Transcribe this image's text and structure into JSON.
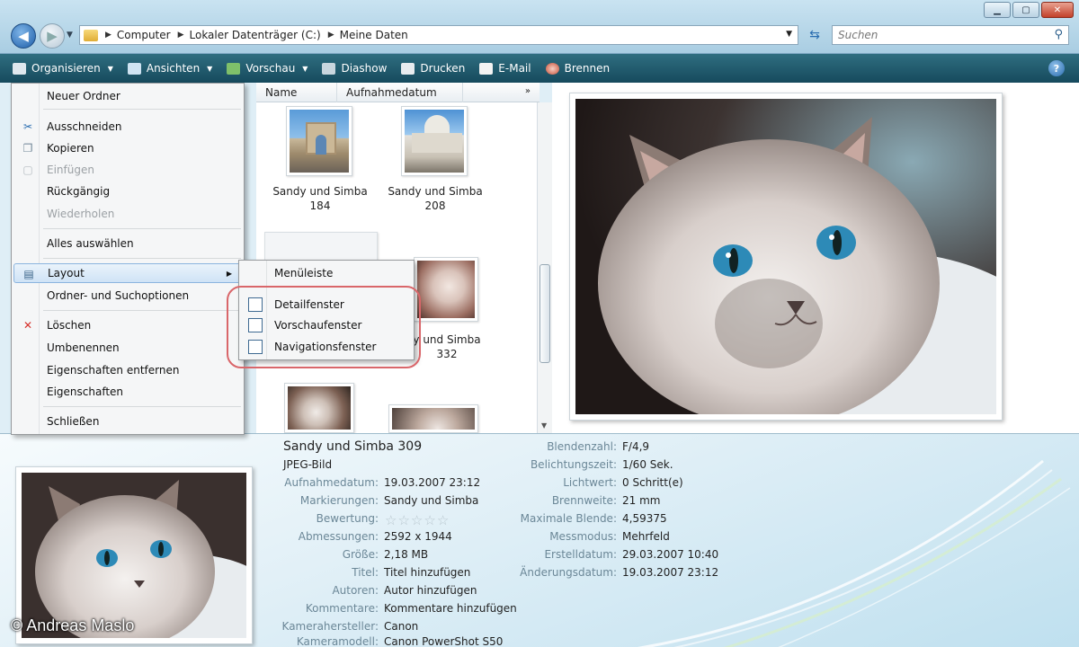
{
  "address": {
    "breadcrumbs": [
      "Computer",
      "Lokaler Datenträger (C:)",
      "Meine Daten"
    ],
    "search_placeholder": "Suchen"
  },
  "toolbar": {
    "items": [
      {
        "label": "Organisieren",
        "icon": "organize-icon",
        "dropdown": true
      },
      {
        "label": "Ansichten",
        "icon": "views-icon",
        "dropdown": true
      },
      {
        "label": "Vorschau",
        "icon": "preview-icon",
        "dropdown": true
      },
      {
        "label": "Diashow",
        "icon": "slideshow-icon",
        "dropdown": false
      },
      {
        "label": "Drucken",
        "icon": "print-icon",
        "dropdown": false
      },
      {
        "label": "E-Mail",
        "icon": "email-icon",
        "dropdown": false
      },
      {
        "label": "Brennen",
        "icon": "burn-icon",
        "dropdown": false
      }
    ],
    "help": "?"
  },
  "filelist": {
    "columns": [
      "Name",
      "Aufnahmedatum"
    ],
    "more": "»",
    "items": [
      {
        "line1": "Sandy und Simba",
        "line2": "184"
      },
      {
        "line1": "Sandy und Simba",
        "line2": "208"
      },
      {
        "line1": "y und Simba",
        "line2": "332"
      }
    ]
  },
  "organize_menu": {
    "items": [
      {
        "label": "Neuer Ordner",
        "disabled": false,
        "icon": ""
      },
      {
        "label": "Ausschneiden",
        "disabled": false,
        "icon": "cut-icon"
      },
      {
        "label": "Kopieren",
        "disabled": false,
        "icon": "copy-icon"
      },
      {
        "label": "Einfügen",
        "disabled": true,
        "icon": "paste-icon"
      },
      {
        "label": "Rückgängig",
        "disabled": false,
        "icon": ""
      },
      {
        "label": "Wiederholen",
        "disabled": true,
        "icon": ""
      },
      {
        "label": "Alles auswählen",
        "disabled": false,
        "icon": ""
      },
      {
        "label": "Layout",
        "disabled": false,
        "icon": "layout-icon",
        "submenu": true
      },
      {
        "label": "Ordner- und Suchoptionen",
        "disabled": false,
        "icon": ""
      },
      {
        "label": "Löschen",
        "disabled": false,
        "icon": "delete-icon"
      },
      {
        "label": "Umbenennen",
        "disabled": false,
        "icon": ""
      },
      {
        "label": "Eigenschaften entfernen",
        "disabled": false,
        "icon": ""
      },
      {
        "label": "Eigenschaften",
        "disabled": false,
        "icon": ""
      },
      {
        "label": "Schließen",
        "disabled": false,
        "icon": ""
      }
    ]
  },
  "layout_submenu": {
    "items": [
      {
        "label": "Menüleiste"
      },
      {
        "label": "Detailfenster"
      },
      {
        "label": "Vorschaufenster"
      },
      {
        "label": "Navigationsfenster"
      }
    ]
  },
  "details": {
    "filename": "Sandy und Simba 309",
    "filetype": "JPEG-Bild",
    "left_props": [
      {
        "label": "Aufnahmedatum:",
        "value": "19.03.2007 23:12"
      },
      {
        "label": "Markierungen:",
        "value": "Sandy und Simba"
      },
      {
        "label": "Bewertung:",
        "value": ""
      },
      {
        "label": "Abmessungen:",
        "value": "2592 x 1944"
      },
      {
        "label": "Größe:",
        "value": "2,18 MB"
      },
      {
        "label": "Titel:",
        "value": "Titel hinzufügen"
      },
      {
        "label": "Autoren:",
        "value": "Autor hinzufügen"
      },
      {
        "label": "Kommentare:",
        "value": "Kommentare hinzufügen"
      },
      {
        "label": "Kamerahersteller:",
        "value": "Canon"
      },
      {
        "label": "Kameramodell:",
        "value": "Canon PowerShot S50"
      }
    ],
    "rating_stars": 0,
    "right_props": [
      {
        "label": "Blendenzahl:",
        "value": "F/4,9"
      },
      {
        "label": "Belichtungszeit:",
        "value": "1/60 Sek."
      },
      {
        "label": "Lichtwert:",
        "value": "0 Schritt(e)"
      },
      {
        "label": "Brennweite:",
        "value": "21 mm"
      },
      {
        "label": "Maximale Blende:",
        "value": "4,59375"
      },
      {
        "label": "Messmodus:",
        "value": "Mehrfeld"
      },
      {
        "label": "Erstelldatum:",
        "value": "29.03.2007 10:40"
      },
      {
        "label": "Änderungsdatum:",
        "value": "19.03.2007 23:12"
      }
    ]
  },
  "copyright": "© Andreas Maslo"
}
